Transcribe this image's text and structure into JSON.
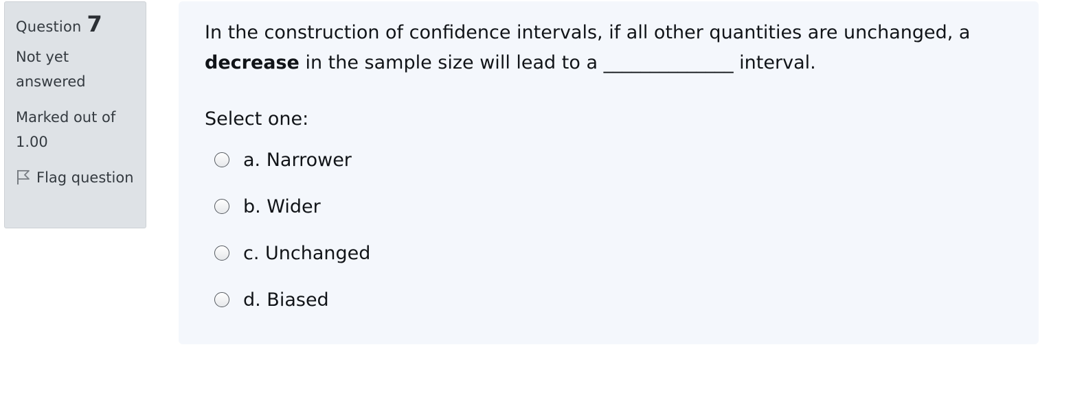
{
  "info": {
    "question_word": "Question",
    "question_number": "7",
    "state": "Not yet answered",
    "grade": "Marked out of 1.00",
    "flag_label": "Flag question",
    "flag_icon": "flag-icon"
  },
  "question": {
    "text_before_bold": "In the construction of confidence intervals, if all other quantities are unchanged, a ",
    "bold_word": "decrease",
    "text_after_bold": " in the sample size will lead to a ______________ interval.",
    "prompt": "Select one:",
    "answers": [
      {
        "label": "a. Narrower",
        "selected": false
      },
      {
        "label": "b. Wider",
        "selected": false
      },
      {
        "label": "c. Unchanged",
        "selected": false
      },
      {
        "label": "d. Biased",
        "selected": false
      }
    ]
  }
}
